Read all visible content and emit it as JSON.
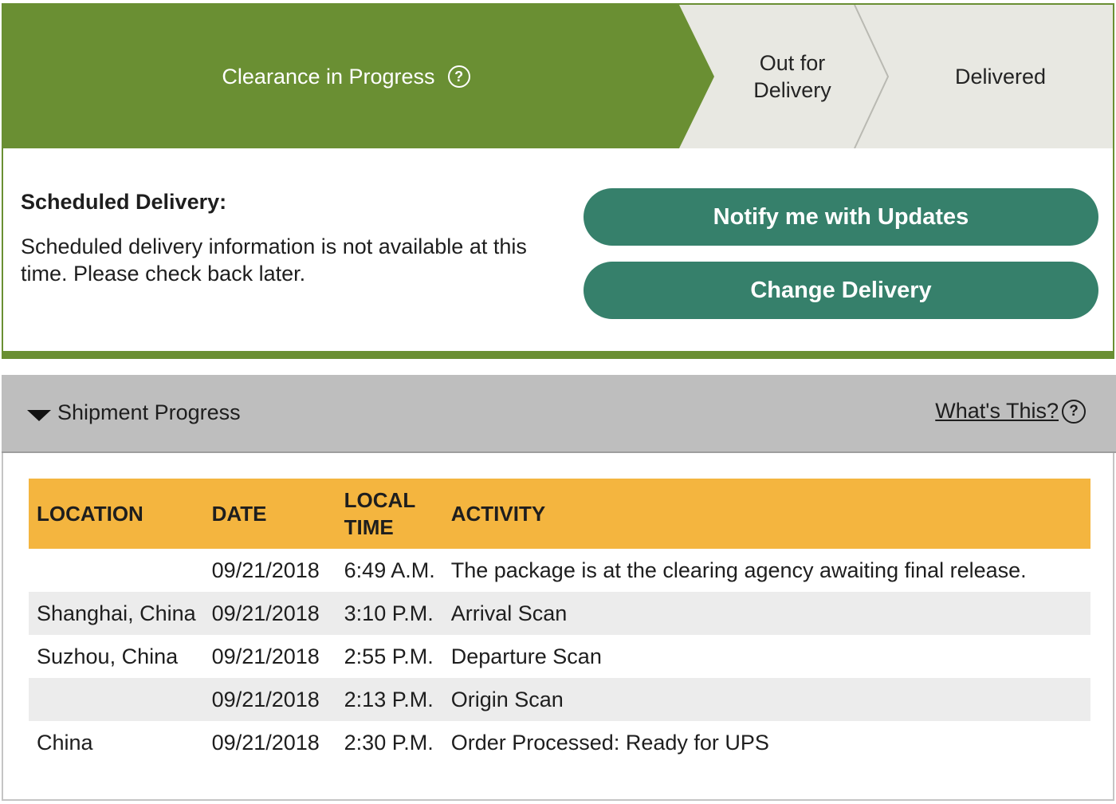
{
  "progress_steps": [
    {
      "label": "Clearance in Progress",
      "state": "active"
    },
    {
      "label": "Out for Delivery",
      "state": "pending"
    },
    {
      "label": "Delivered",
      "state": "pending"
    }
  ],
  "help_icon_glyph": "?",
  "scheduled": {
    "title": "Scheduled Delivery:",
    "message": "Scheduled delivery information is not available at this time. Please check back later."
  },
  "actions": {
    "notify_label": "Notify me with Updates",
    "change_label": "Change Delivery"
  },
  "shipment_progress": {
    "title": "Shipment Progress",
    "whats_this": "What's This?",
    "columns": [
      "LOCATION",
      "DATE",
      "LOCAL TIME",
      "ACTIVITY"
    ],
    "rows": [
      {
        "location": "",
        "date": "09/21/2018",
        "time": "6:49 A.M.",
        "activity": "The package is at the clearing agency awaiting final release."
      },
      {
        "location": "Shanghai,  China",
        "date": "09/21/2018",
        "time": "3:10 P.M.",
        "activity": "Arrival Scan"
      },
      {
        "location": "Suzhou,  China",
        "date": "09/21/2018",
        "time": "2:55 P.M.",
        "activity": "Departure Scan"
      },
      {
        "location": "",
        "date": "09/21/2018",
        "time": "2:13 P.M.",
        "activity": "Origin Scan"
      },
      {
        "location": "China",
        "date": "09/21/2018",
        "time": "2:30 P.M.",
        "activity": "Order Processed: Ready for UPS"
      }
    ]
  },
  "colors": {
    "active_step": "#6a8f33",
    "pending_step": "#e8e8e2",
    "button": "#36806b",
    "table_header": "#f4b53f",
    "panel_header": "#bebebe"
  }
}
